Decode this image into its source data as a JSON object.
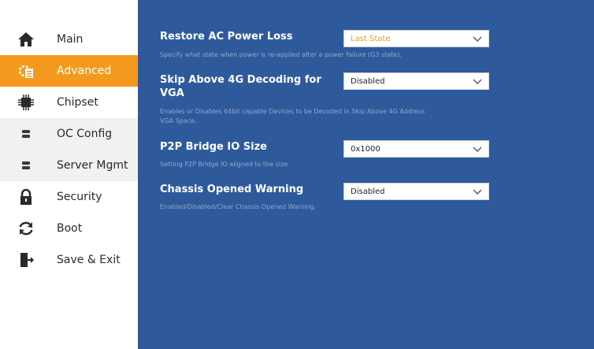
{
  "colors": {
    "accent": "#f39a1e",
    "panel": "#2e5a9c"
  },
  "sidebar": {
    "items": [
      {
        "label": "Main",
        "icon": "home-icon"
      },
      {
        "label": "Advanced",
        "icon": "gear-doc-icon",
        "active": true
      },
      {
        "label": "Chipset",
        "icon": "chip-icon"
      },
      {
        "label": "OC Config",
        "icon": "server-icon"
      },
      {
        "label": "Server Mgmt",
        "icon": "server-icon"
      },
      {
        "label": "Security",
        "icon": "lock-icon"
      },
      {
        "label": "Boot",
        "icon": "refresh-icon"
      },
      {
        "label": "Save & Exit",
        "icon": "exit-door-icon"
      }
    ]
  },
  "settings": [
    {
      "title": "Restore AC Power Loss",
      "value": "Last State",
      "desc": "Specify what state when power is re-applied after a power failure (G3 state)."
    },
    {
      "title_line1": "Skip Above 4G Decoding for",
      "title_line2": "VGA",
      "value": "Disabled",
      "desc_line1": "Enables or Disables 64bit capable Devices to be Decoded in Skip Above 4G Address",
      "desc_line2": "VGA Space."
    },
    {
      "title": "P2P Bridge IO Size",
      "value": "0x1000",
      "desc": "Setting P2P Bridge IO aligned to the size"
    },
    {
      "title": "Chassis Opened Warning",
      "value": "Disabled",
      "desc": "Enabled/Disabled/Clear Chassis Opened Warning."
    }
  ]
}
